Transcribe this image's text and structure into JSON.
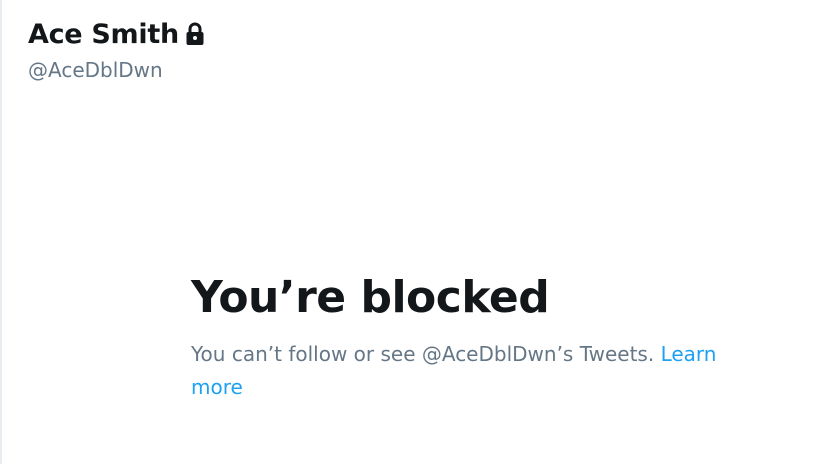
{
  "profile": {
    "display_name": "Ace Smith",
    "lock_icon": "lock-icon",
    "handle": "@AceDblDwn"
  },
  "blocked": {
    "title": "You’re blocked",
    "message": "You can’t follow or see @AceDblDwn’s Tweets.",
    "link_label": "Learn more"
  },
  "colors": {
    "text_primary": "#14171a",
    "text_secondary": "#657786",
    "link": "#1da1f2"
  }
}
